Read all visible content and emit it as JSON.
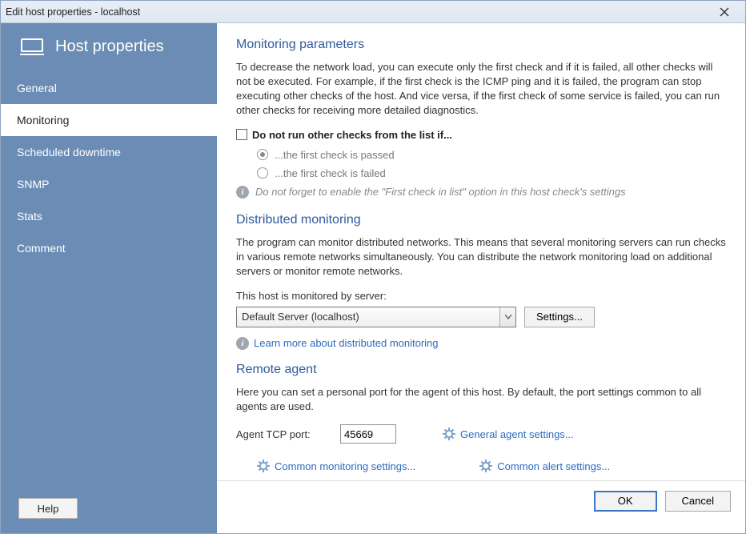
{
  "window": {
    "title": "Edit host properties - localhost"
  },
  "sidebar": {
    "title": "Host properties",
    "items": [
      {
        "label": "General"
      },
      {
        "label": "Monitoring"
      },
      {
        "label": "Scheduled downtime"
      },
      {
        "label": "SNMP"
      },
      {
        "label": "Stats"
      },
      {
        "label": "Comment"
      }
    ],
    "active_index": 1,
    "help_label": "Help"
  },
  "sections": {
    "monitoring": {
      "title": "Monitoring parameters",
      "desc": "To decrease the network load, you can execute only the first check and if it is failed, all other checks will not be executed. For example, if the first check is the ICMP ping and it is failed, the program can stop executing other checks of the host. And vice versa, if the first check of some service is failed, you can run other checks for receiving more detailed diagnostics.",
      "checkbox_label": "Do not run other checks from the list if...",
      "radio_passed": "...the first check is passed",
      "radio_failed": "...the first check is failed",
      "info_hint": "Do not forget to enable the \"First check in list\" option in this host check's settings"
    },
    "distributed": {
      "title": "Distributed monitoring",
      "desc": "The program can monitor distributed networks. This means that several monitoring servers can run checks in various remote networks simultaneously. You can distribute the network monitoring load on additional servers or monitor remote networks.",
      "server_label": "This host is monitored by server:",
      "server_value": "Default Server (localhost)",
      "settings_btn": "Settings...",
      "learn_link": "Learn more about distributed monitoring"
    },
    "remote": {
      "title": "Remote agent",
      "desc": "Here you can set a personal port for the agent of this host. By default, the port settings common to all agents are used.",
      "port_label": "Agent TCP port:",
      "port_value": "45669",
      "general_link": "General agent settings...",
      "common_monitoring_link": "Common monitoring settings...",
      "common_alert_link": "Common alert settings..."
    }
  },
  "footer": {
    "ok": "OK",
    "cancel": "Cancel"
  }
}
